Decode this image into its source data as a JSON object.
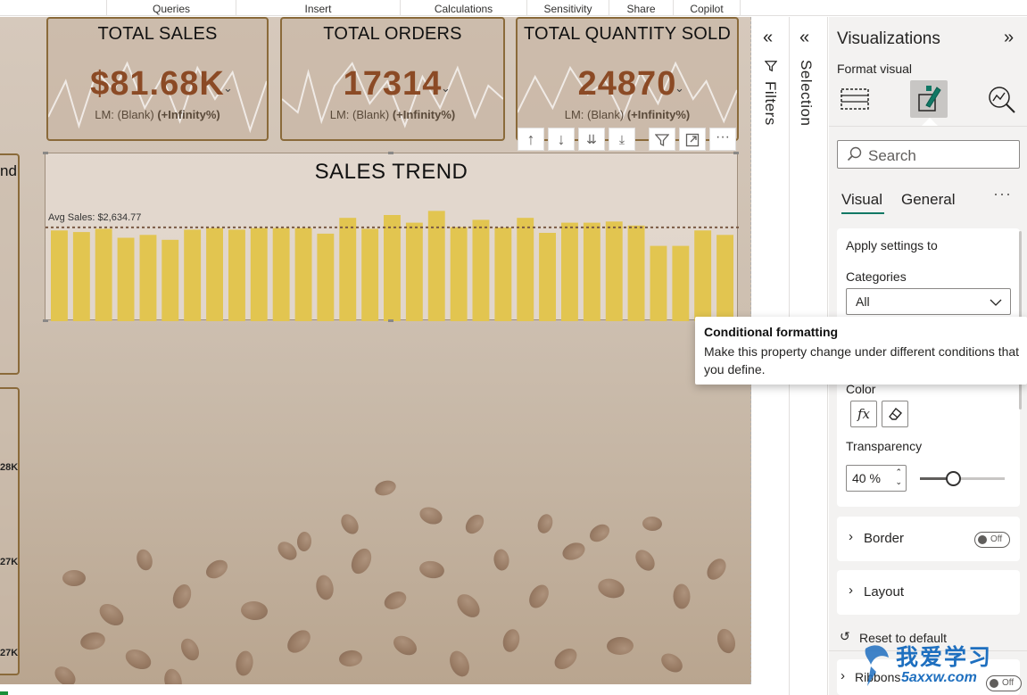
{
  "ribbon": {
    "groups": [
      "Queries",
      "Insert",
      "Calculations",
      "Sensitivity",
      "Share",
      "Copilot"
    ]
  },
  "kpis": [
    {
      "title": "TOTAL SALES",
      "value": "$81.68K",
      "sub_prefix": "LM: (Blank)",
      "sub_change": "(+Infinity%)"
    },
    {
      "title": "TOTAL ORDERS",
      "value": "17314",
      "sub_prefix": "LM: (Blank)",
      "sub_change": "(+Infinity%)"
    },
    {
      "title": "TOTAL QUANTITY SOLD",
      "value": "24870",
      "sub_prefix": "LM: (Blank)",
      "sub_change": "(+Infinity%)"
    }
  ],
  "left_panel": {
    "partial_label": "nd",
    "ticks": [
      "28K",
      "27K",
      "27K"
    ]
  },
  "trend": {
    "title": "SALES TREND",
    "avg_label": "Avg Sales: $2,634.77"
  },
  "chart_data": {
    "type": "bar",
    "title": "SALES TREND",
    "bar_color": "#e2c550",
    "avg_line_color": "#7a5a45",
    "reference_line": {
      "label": "Avg Sales: $2,634.77",
      "value": 2634.77
    },
    "values": [
      2560,
      2520,
      2600,
      2380,
      2450,
      2330,
      2580,
      2620,
      2580,
      2620,
      2620,
      2620,
      2480,
      2870,
      2600,
      2940,
      2750,
      3040,
      2640,
      2820,
      2630,
      2870,
      2500,
      2750,
      2750,
      2780,
      2680,
      2180,
      2180,
      2560,
      2450
    ],
    "ylim": [
      0,
      3400
    ],
    "grid": false
  },
  "visual_toolbar": {
    "icons": [
      "arrow-up-icon",
      "arrow-down-icon",
      "drill-all-icon",
      "expand-hierarchy-icon",
      "filter-icon",
      "focus-mode-icon",
      "more-options-icon"
    ]
  },
  "filters_strip": {
    "label": "Filters"
  },
  "selection_strip": {
    "label": "Selection"
  },
  "viz_pane": {
    "title": "Visualizations",
    "format_visual": "Format visual",
    "search_placeholder": "Search",
    "tabs": {
      "visual": "Visual",
      "general": "General"
    },
    "apply_settings_to": "Apply settings to",
    "categories_label": "Categories",
    "categories_value": "All",
    "color_label": "Color",
    "transparency_label": "Transparency",
    "transparency_value": "40 %",
    "transparency_level": 0.4,
    "sections": [
      {
        "label": "Border",
        "toggle": "Off"
      },
      {
        "label": "Layout",
        "toggle": "Off"
      }
    ],
    "reset_label": "Reset to default",
    "ribbons_label": "Ribbons",
    "ribbons_toggle": "Off"
  },
  "tooltip": {
    "title": "Conditional formatting",
    "body": "Make this property change under different conditions that you define."
  },
  "watermark": {
    "top": "我爱学习",
    "bottom": "5axxw.com"
  },
  "colors": {
    "accent_teal": "#117865",
    "kpi_value": "#8b4a25",
    "card_border": "#8a6a3a"
  }
}
